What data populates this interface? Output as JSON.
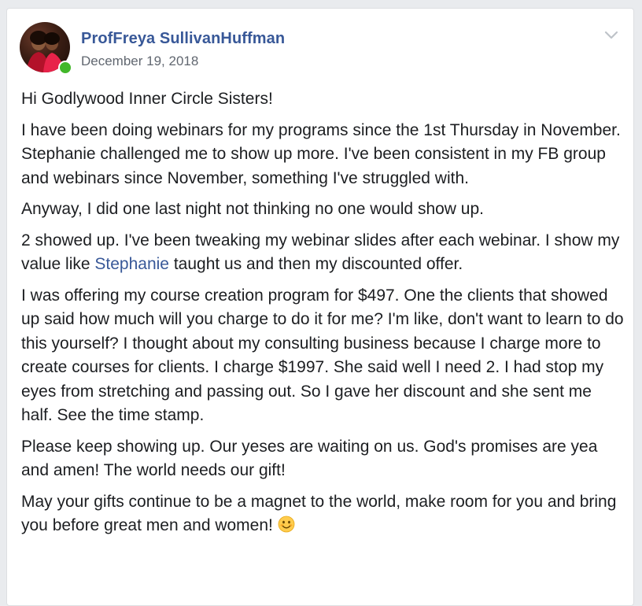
{
  "post": {
    "author": "ProfFreya SullivanHuffman",
    "timestamp": "December 19, 2018",
    "paragraphs": {
      "p0": "Hi Godlywood Inner Circle Sisters!",
      "p1": "I have been doing webinars for my programs since the 1st Thursday in November. Stephanie challenged me to show up more. I've been consistent in my FB group and webinars since November, something I've struggled with.",
      "p2": "Anyway, I did one last night not thinking no one would show up.",
      "p3_before": "2 showed up. I've been tweaking my webinar slides after each webinar. I show my value like ",
      "p3_mention": "Stephanie",
      "p3_after": " taught us and then my discounted offer.",
      "p4": "I was offering my course creation program for $497. One the clients that showed up said how much will you charge to do it for me? I'm like, don't want to learn to do this yourself? I thought about my consulting business because I charge more to create courses for clients. I charge $1997. She said well I need 2. I had stop my eyes from stretching and passing out. So I gave her discount and she sent me half. See the time stamp.",
      "p5": "Please keep showing up. Our yeses are waiting on us. God's promises are yea and amen! The world needs our gift!",
      "p6": "May your gifts continue to be a magnet to the world, make room for you and bring you before great men and women! "
    },
    "emoji_icon": "smiling-face-emoji",
    "online_status": "online"
  },
  "colors": {
    "link": "#385898",
    "text": "#1c1e21",
    "meta": "#616770",
    "online": "#42b72a"
  }
}
